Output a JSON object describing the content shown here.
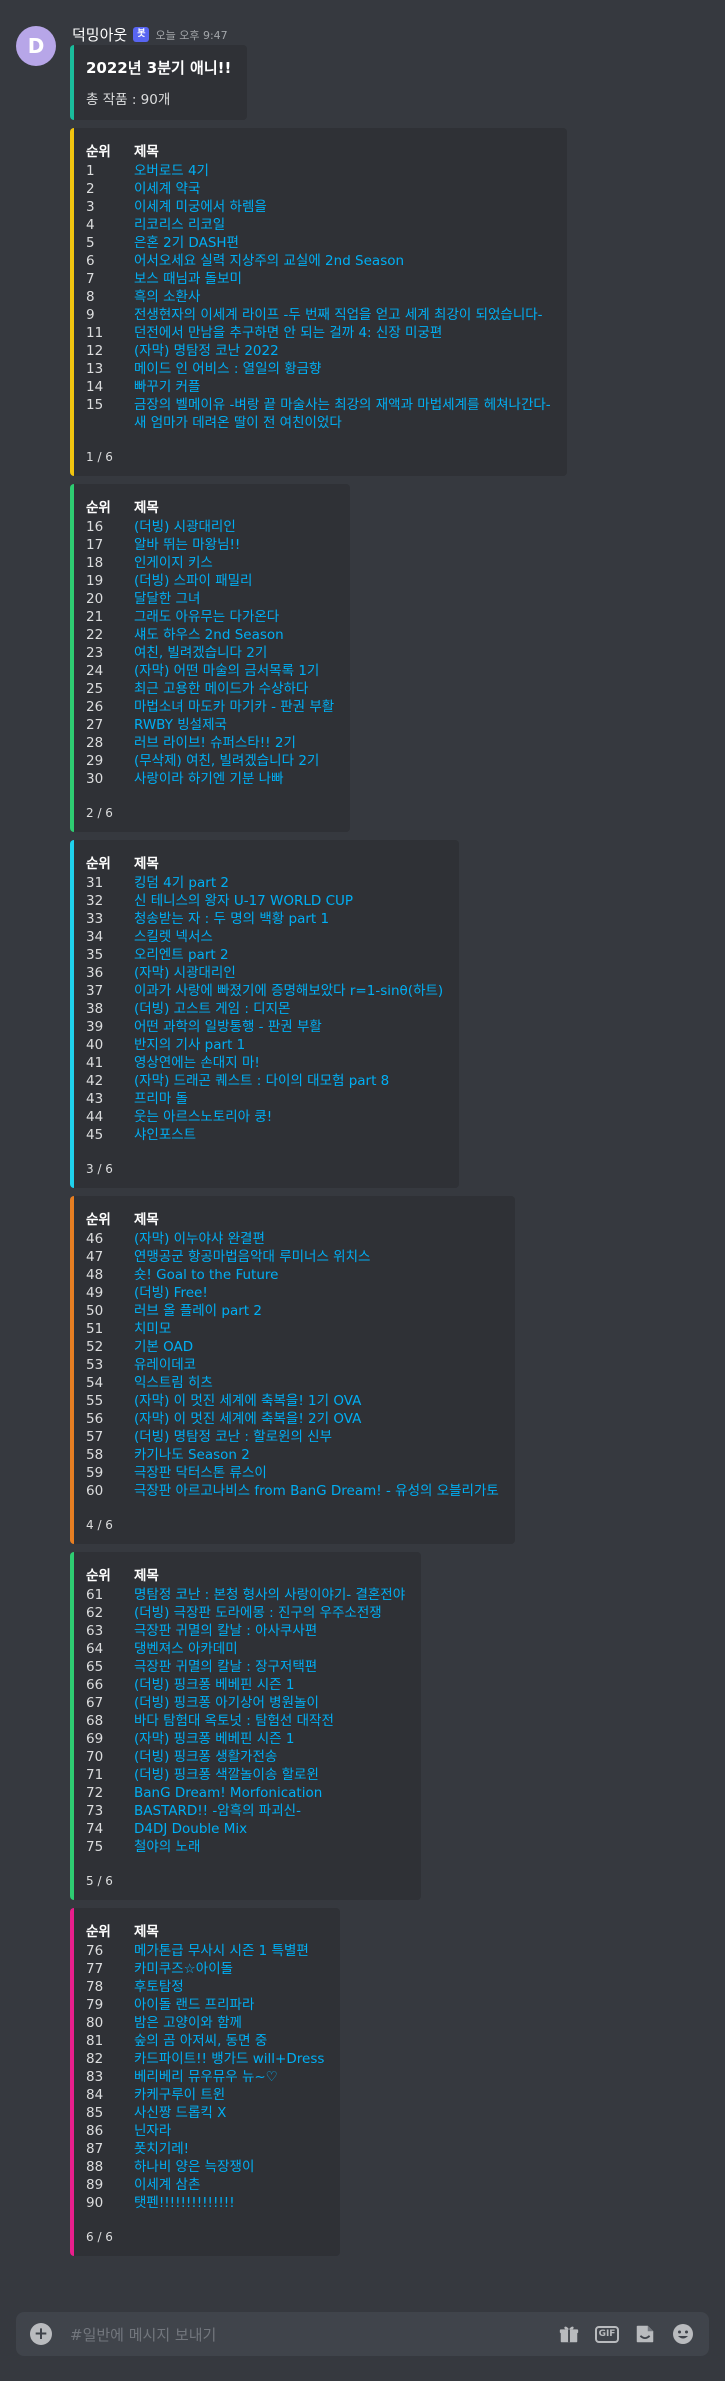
{
  "author": {
    "avatar_letter": "D",
    "username": "덕밍아웃",
    "bot_tag": "봇",
    "timestamp": "오늘 오후 9:47"
  },
  "summary": {
    "title": "2022년 3분기 애니!!",
    "description": "총 작품 : 90개",
    "color": "#1abc9c"
  },
  "columns": {
    "rank": "순위",
    "title": "제목"
  },
  "pages": [
    {
      "color": "#f1c40f",
      "footer": "1 / 6",
      "items": [
        [
          "1",
          "오버로드 4기"
        ],
        [
          "2",
          "이세계 약국"
        ],
        [
          "3",
          "이세계 미궁에서 하렘을"
        ],
        [
          "4",
          "리코리스 리코일"
        ],
        [
          "5",
          "은혼 2기 DASH편"
        ],
        [
          "6",
          "어서오세요 실력 지상주의 교실에 2nd Season"
        ],
        [
          "7",
          "보스 때님과 돌보미"
        ],
        [
          "8",
          "흑의 소환사"
        ],
        [
          "9",
          "전생현자의 이세계 라이프 -두 번째 직업을 얻고 세계 최강이 되었습니다-"
        ],
        [
          "11",
          "던전에서 만남을 추구하면 안 되는 걸까 4: 신장 미궁편"
        ],
        [
          "12",
          "(자막) 명탐정 코난 2022"
        ],
        [
          "13",
          "메이드 인 어비스 : 열일의 황금향"
        ],
        [
          "14",
          "빠꾸기 커플"
        ],
        [
          "15",
          "금장의 벨메이유 -벼랑 끝 마술사는 최강의 재액과 마법세계를 헤쳐나간다-"
        ],
        [
          "",
          "새 엄마가 데려온 딸이 전 여친이었다"
        ]
      ]
    },
    {
      "color": "#2ecc71",
      "footer": "2 / 6",
      "items": [
        [
          "16",
          "(더빙) 시광대리인"
        ],
        [
          "17",
          "알바 뛰는 마왕님!!"
        ],
        [
          "18",
          "인게이지 키스"
        ],
        [
          "19",
          "(더빙) 스파이 패밀리"
        ],
        [
          "20",
          "달달한 그녀"
        ],
        [
          "21",
          "그래도 아유무는 다가온다"
        ],
        [
          "22",
          "섀도 하우스 2nd Season"
        ],
        [
          "23",
          "여친, 빌려겠습니다 2기"
        ],
        [
          "24",
          "(자막) 어떤 마술의 금서목록 1기"
        ],
        [
          "25",
          "최근 고용한 메이드가 수상하다"
        ],
        [
          "26",
          "마법소녀 마도카 마기카 - 판권 부활"
        ],
        [
          "27",
          "RWBY 빙설제국"
        ],
        [
          "28",
          "러브 라이브! 슈퍼스타!! 2기"
        ],
        [
          "29",
          "(무삭제) 여친, 빌려겠습니다 2기"
        ],
        [
          "30",
          "사랑이라 하기엔 기분 나빠"
        ]
      ]
    },
    {
      "color": "#1fd1ed",
      "footer": "3 / 6",
      "items": [
        [
          "31",
          "킹덤 4기 part 2"
        ],
        [
          "32",
          "신 테니스의 왕자 U-17 WORLD CUP"
        ],
        [
          "33",
          "청송받는 자 : 두 명의 백황 part 1"
        ],
        [
          "34",
          "스킬렛 넥서스"
        ],
        [
          "35",
          "오리엔트 part 2"
        ],
        [
          "36",
          "(자막) 시광대리인"
        ],
        [
          "37",
          "이과가 사랑에 빠졌기에 증명해보았다 r=1-sinθ(하트)"
        ],
        [
          "38",
          "(더빙) 고스트 게임 : 디지몬"
        ],
        [
          "39",
          "어떤 과학의 일방통행 - 판권 부활"
        ],
        [
          "40",
          "반지의 기사 part 1"
        ],
        [
          "41",
          "영상연에는 손대지 마!"
        ],
        [
          "42",
          "(자막) 드래곤 퀘스트 : 다이의 대모험 part 8"
        ],
        [
          "43",
          "프리마 돌"
        ],
        [
          "44",
          "웃는 아르스노토리아 쿵!"
        ],
        [
          "45",
          "샤인포스트"
        ]
      ]
    },
    {
      "color": "#e67e22",
      "footer": "4 / 6",
      "items": [
        [
          "46",
          "(자막) 이누야샤 완결편"
        ],
        [
          "47",
          "연맹공군 항공마법음악대 루미너스 위치스"
        ],
        [
          "48",
          "숏! Goal to the Future"
        ],
        [
          "49",
          "(더빙) Free!"
        ],
        [
          "50",
          "러브 올 플레이 part 2"
        ],
        [
          "51",
          "치미모"
        ],
        [
          "52",
          "기본 OAD"
        ],
        [
          "53",
          "유레이데코"
        ],
        [
          "54",
          "익스트림 히츠"
        ],
        [
          "55",
          "(자막) 이 멋진 세계에 축복을! 1기 OVA"
        ],
        [
          "56",
          "(자막) 이 멋진 세계에 축복을! 2기 OVA"
        ],
        [
          "57",
          "(더빙) 명탐정 코난 : 할로윈의 신부"
        ],
        [
          "58",
          "카기나도 Season 2"
        ],
        [
          "59",
          "극장판 닥터스톤 류스이"
        ],
        [
          "60",
          "극장판 아르고나비스 from BanG Dream! - 유성의 오블리가토"
        ]
      ]
    },
    {
      "color": "#2ecc71",
      "footer": "5 / 6",
      "items": [
        [
          "61",
          "명탐정 코난 : 본청 형사의 사랑이야기- 결혼전야"
        ],
        [
          "62",
          "(더빙) 극장판 도라에몽 : 진구의 우주소전쟁"
        ],
        [
          "63",
          "극장판 귀멸의 칼날 : 아사쿠사편"
        ],
        [
          "64",
          "댕벤져스 아카데미"
        ],
        [
          "65",
          "극장판 귀멸의 칼날 : 장구저택편"
        ],
        [
          "66",
          "(더빙) 핑크퐁 베베핀 시즌 1"
        ],
        [
          "67",
          "(더빙) 핑크퐁 아기상어 병원놀이"
        ],
        [
          "68",
          "바다 탐험대 옥토넛 : 탐험선 대작전"
        ],
        [
          "69",
          "(자막) 핑크퐁 베베핀 시즌 1"
        ],
        [
          "70",
          "(더빙) 핑크퐁 생활가전송"
        ],
        [
          "71",
          "(더빙) 핑크퐁 색깔놀이송 할로윈"
        ],
        [
          "72",
          "BanG Dream! Morfonication"
        ],
        [
          "73",
          "BASTARD!! -암흑의 파괴신-"
        ],
        [
          "74",
          "D4DJ Double Mix"
        ],
        [
          "75",
          "철야의 노래"
        ]
      ]
    },
    {
      "color": "#e91e8c",
      "footer": "6 / 6",
      "items": [
        [
          "76",
          "메가톤급 무사시 시즌 1 특별편"
        ],
        [
          "77",
          "카미쿠즈☆아이돌"
        ],
        [
          "78",
          "후토탐정"
        ],
        [
          "79",
          "아이돌 랜드 프리파라"
        ],
        [
          "80",
          "밤은 고양이와 함께"
        ],
        [
          "81",
          "숲의 곰 아저씨, 동면 중"
        ],
        [
          "82",
          "카드파이트!! 뱅가드 will+Dress"
        ],
        [
          "83",
          "베리베리 뮤우뮤우 뉴~♡"
        ],
        [
          "84",
          "카케구루이 트윈"
        ],
        [
          "85",
          "사신짱 드롭킥 X"
        ],
        [
          "86",
          "닌자라"
        ],
        [
          "87",
          "폿치기레!"
        ],
        [
          "88",
          "하나비 양은 늑장쟁이"
        ],
        [
          "89",
          "이세계 삼촌"
        ],
        [
          "90",
          "탯펜!!!!!!!!!!!!!!"
        ]
      ]
    }
  ],
  "input": {
    "placeholder": "#일반에 메시지 보내기",
    "plus": "+",
    "gif": "GIF",
    "icons": [
      "gift-icon",
      "gif-icon",
      "sticker-icon",
      "emoji-icon"
    ]
  }
}
